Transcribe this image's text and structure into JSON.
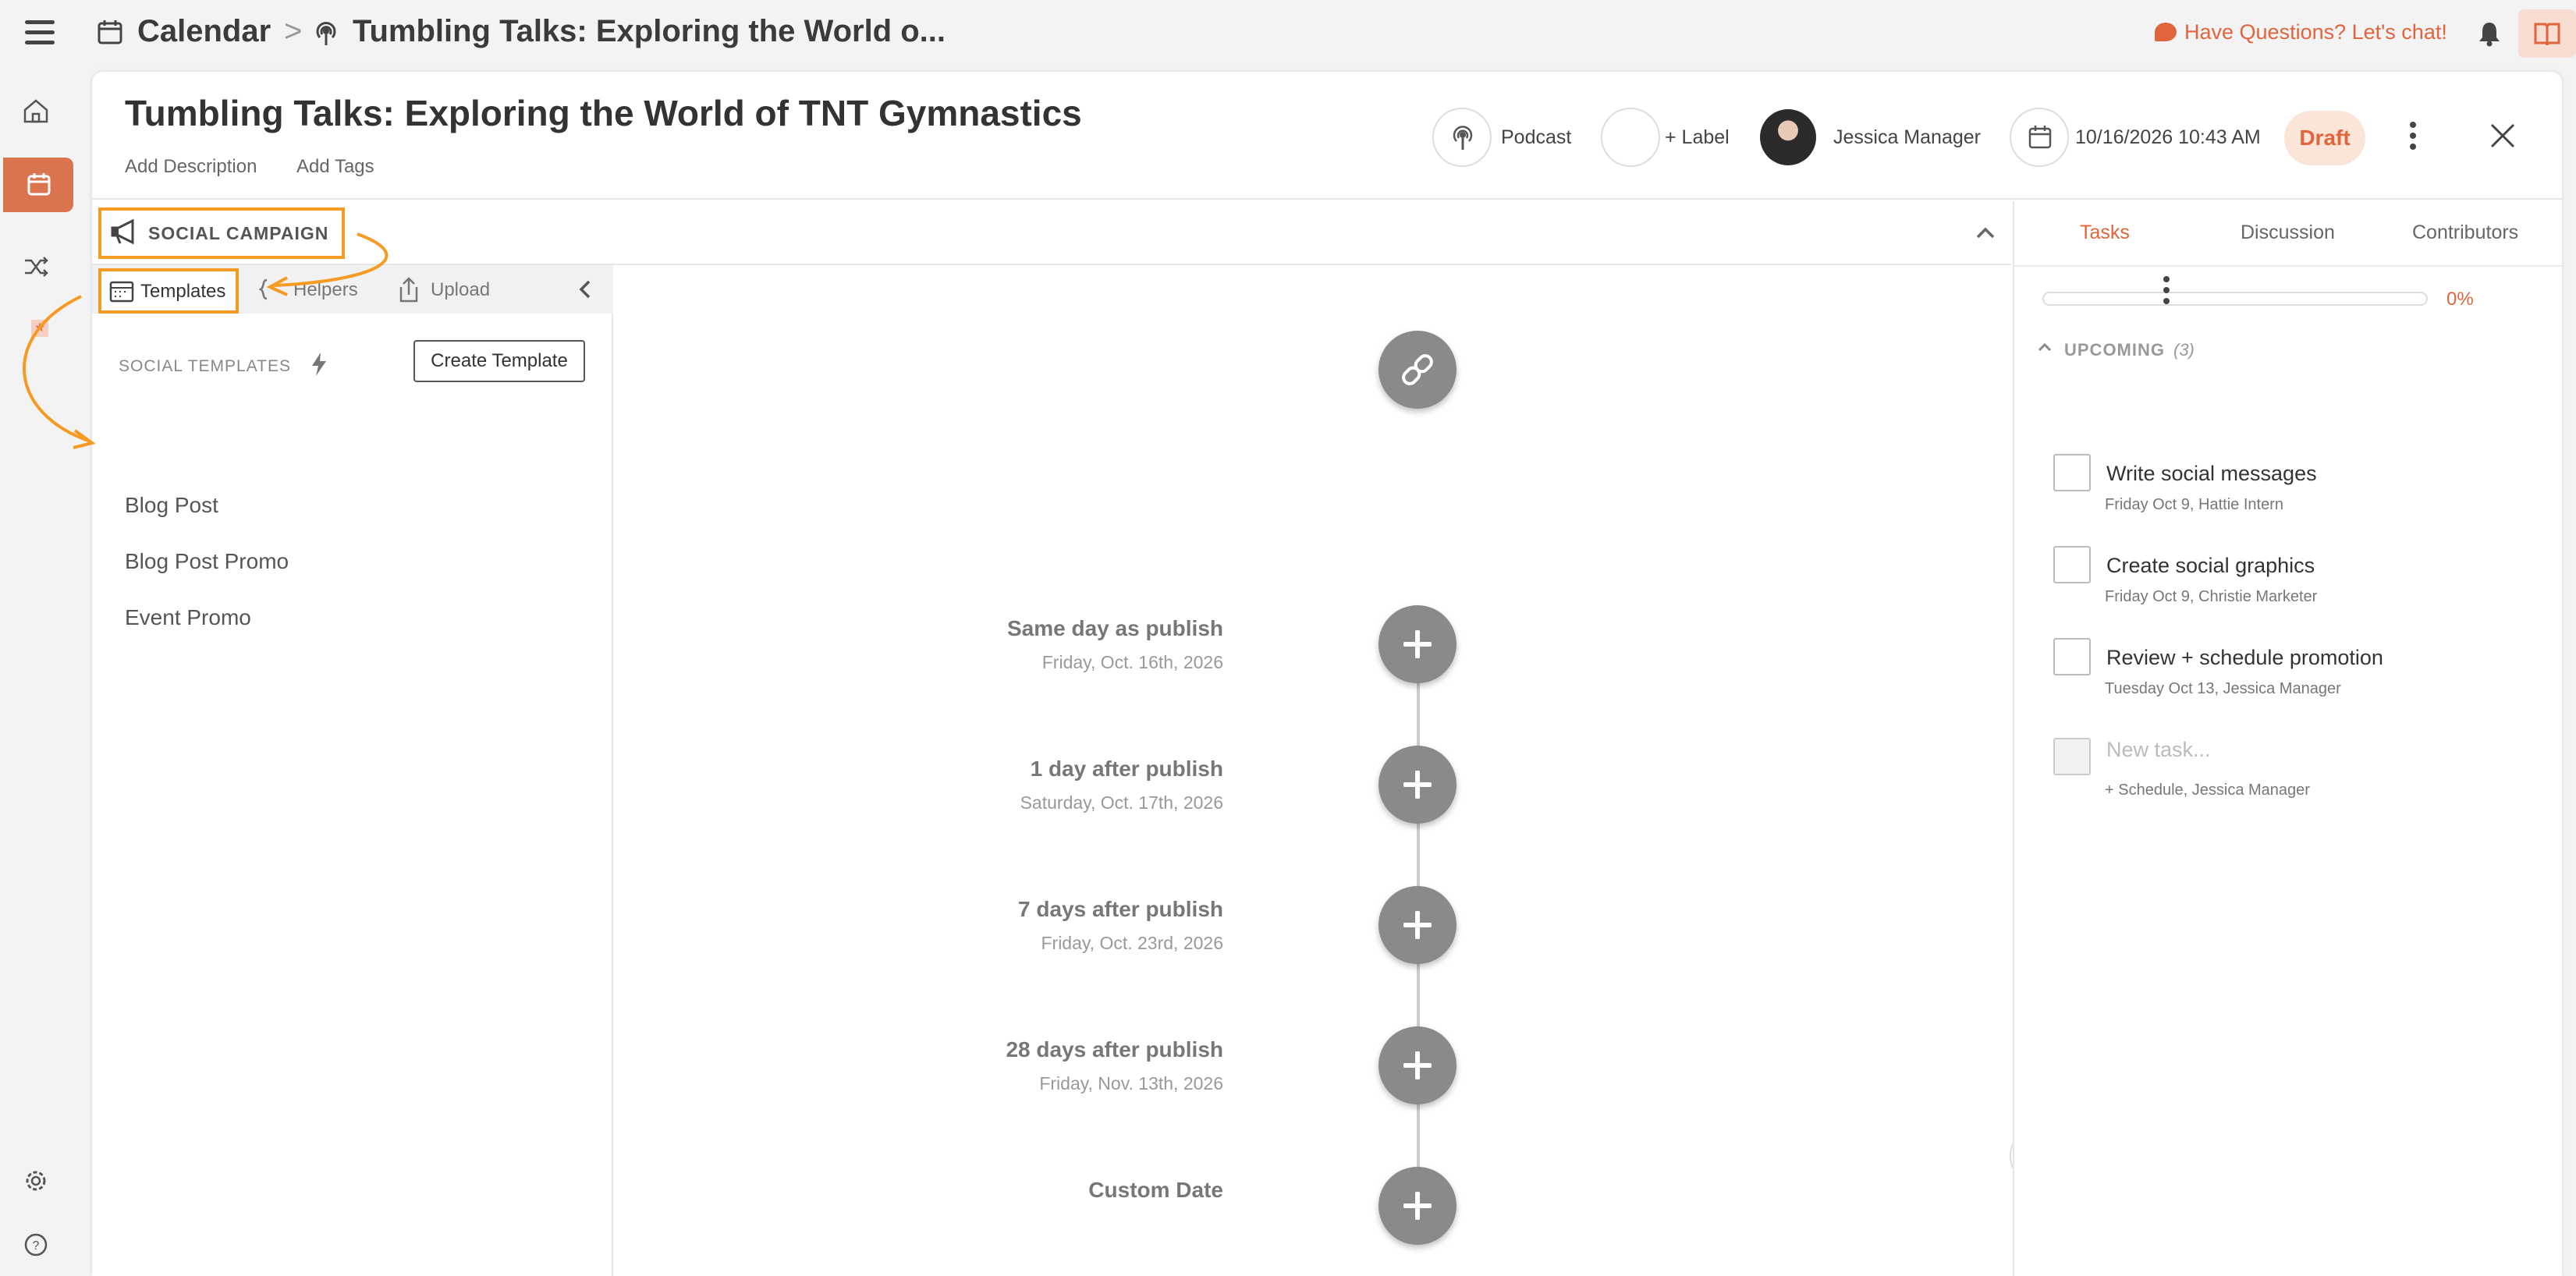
{
  "topbar": {
    "breadcrumb_root": "Calendar",
    "breadcrumb_separator": ">",
    "breadcrumb_title": "Tumbling Talks: Exploring the World o...",
    "chat_link": "Have Questions? Let's chat!",
    "accent_color": "#e0643c"
  },
  "rail": {
    "icons": [
      "home-icon",
      "calendar-icon",
      "shuffle-icon",
      "star-icon",
      "gear-icon",
      "help-icon"
    ],
    "active": "calendar-icon"
  },
  "header": {
    "title": "Tumbling Talks: Exploring the World of TNT Gymnastics",
    "add_description": "Add Description",
    "add_tags": "Add Tags",
    "type_label": "Podcast",
    "label_button": "+ Label",
    "owner_name": "Jessica Manager",
    "datetime": "10/16/2026 10:43 AM",
    "status": "Draft"
  },
  "campaign": {
    "section_label": "SOCIAL CAMPAIGN",
    "tabs": {
      "templates": "Templates",
      "helpers": "Helpers",
      "upload": "Upload"
    },
    "templates_heading": "SOCIAL TEMPLATES",
    "create_template": "Create Template",
    "templates": [
      "Blog Post",
      "Blog Post Promo",
      "Event Promo"
    ],
    "annotation_color": "#f59a23"
  },
  "timeline": {
    "slots": [
      {
        "label": "Same day as publish",
        "date": "Friday, Oct. 16th, 2026"
      },
      {
        "label": "1 day after publish",
        "date": "Saturday, Oct. 17th, 2026"
      },
      {
        "label": "7 days after publish",
        "date": "Friday, Oct. 23rd, 2026"
      },
      {
        "label": "28 days after publish",
        "date": "Friday, Nov. 13th, 2026"
      },
      {
        "label": "Custom Date",
        "date": ""
      }
    ]
  },
  "sidebar": {
    "tabs": [
      "Tasks",
      "Discussion",
      "Contributors"
    ],
    "active_tab": "Tasks",
    "progress_percent": 0,
    "progress_label": "0%",
    "upcoming_label": "UPCOMING",
    "upcoming_count": "(3)",
    "tasks": [
      {
        "title": "Write social messages",
        "meta": "Friday Oct 9,   Hattie Intern"
      },
      {
        "title": "Create social graphics",
        "meta": "Friday Oct 9,   Christie Marketer"
      },
      {
        "title": "Review + schedule promotion",
        "meta": "Tuesday Oct 13,   Jessica Manager"
      }
    ],
    "new_task_placeholder": "New task...",
    "new_task_meta": "+ Schedule,   Jessica Manager"
  }
}
